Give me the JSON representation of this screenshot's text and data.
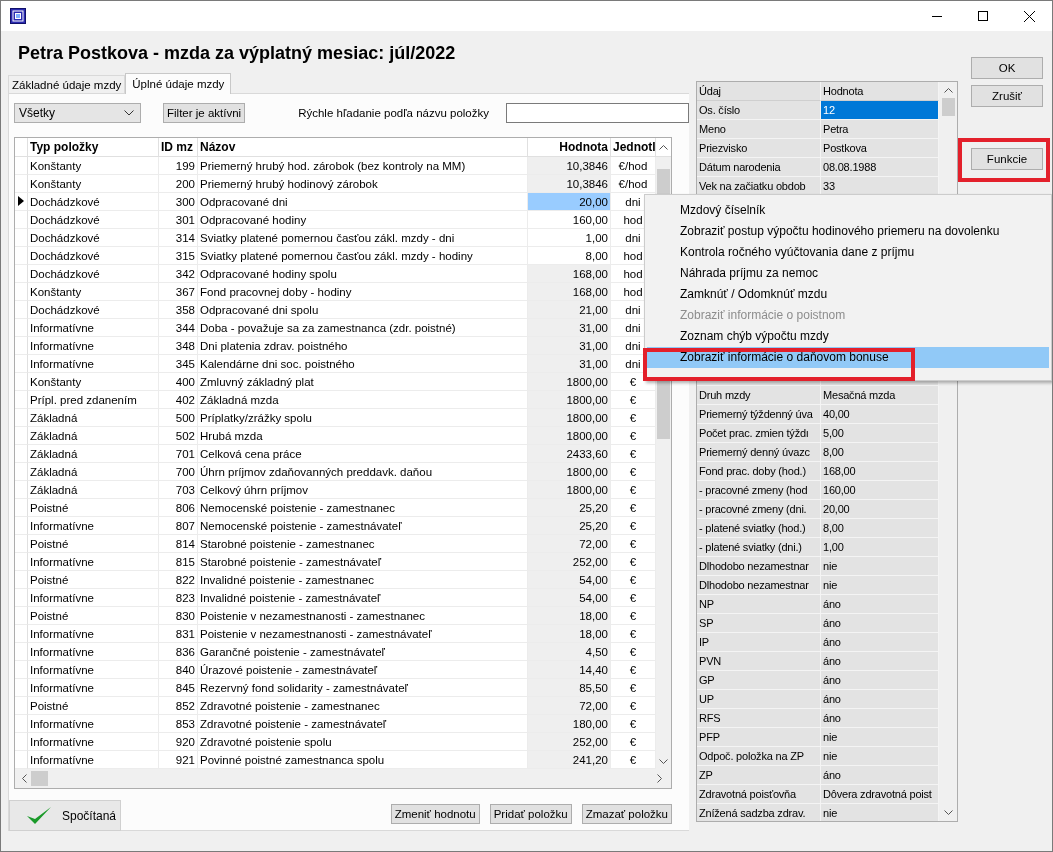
{
  "heading": "Petra Postkova - mzda za výplatný mesiac: júl/2022",
  "tabs": [
    {
      "label": "Základné údaje mzdy",
      "selected": false
    },
    {
      "label": "Úplné údaje mzdy",
      "selected": true
    }
  ],
  "filter": {
    "dropdown": "Všetky",
    "filter_button": "Filter je aktívni",
    "search_label": "Rýchle hľadanie podľa názvu položky"
  },
  "table": {
    "columns": [
      "Typ položky",
      "ID mz",
      "Názov",
      "Hodnota",
      "Jednotl"
    ],
    "rows": [
      {
        "type": "Konštanty",
        "id": "199",
        "name": "Priemerný hrubý hod. zárobok (bez kontroly na MM)",
        "value": "10,3846",
        "unit": "€/hod",
        "editable": false,
        "selected": false
      },
      {
        "type": "Konštanty",
        "id": "200",
        "name": "Priemerný hrubý hodinový zárobok",
        "value": "10,3846",
        "unit": "€/hod",
        "editable": false,
        "selected": false
      },
      {
        "type": "Dochádzkové",
        "id": "300",
        "name": "Odpracované dni",
        "value": "20,00",
        "unit": "dni",
        "editable": true,
        "selected": true
      },
      {
        "type": "Dochádzkové",
        "id": "301",
        "name": "Odpracované hodiny",
        "value": "160,00",
        "unit": "hod",
        "editable": true,
        "selected": false
      },
      {
        "type": "Dochádzkové",
        "id": "314",
        "name": "Sviatky platené pomernou časťou zákl. mzdy - dni",
        "value": "1,00",
        "unit": "dni",
        "editable": true,
        "selected": false
      },
      {
        "type": "Dochádzkové",
        "id": "315",
        "name": "Sviatky platené pomernou časťou zákl. mzdy - hodiny",
        "value": "8,00",
        "unit": "hod",
        "editable": true,
        "selected": false
      },
      {
        "type": "Dochádzkové",
        "id": "342",
        "name": "Odpracované hodiny spolu",
        "value": "168,00",
        "unit": "hod",
        "editable": false,
        "selected": false
      },
      {
        "type": "Konštanty",
        "id": "367",
        "name": "Fond pracovnej doby - hodiny",
        "value": "168,00",
        "unit": "hod",
        "editable": false,
        "selected": false
      },
      {
        "type": "Dochádzkové",
        "id": "358",
        "name": "Odpracované dni spolu",
        "value": "21,00",
        "unit": "dni",
        "editable": false,
        "selected": false
      },
      {
        "type": "Informatívne",
        "id": "344",
        "name": "Doba - považuje sa za zamestnanca (zdr. poistné)",
        "value": "31,00",
        "unit": "dni",
        "editable": false,
        "selected": false
      },
      {
        "type": "Informatívne",
        "id": "348",
        "name": "Dni platenia zdrav. poistného",
        "value": "31,00",
        "unit": "dni",
        "editable": false,
        "selected": false
      },
      {
        "type": "Informatívne",
        "id": "345",
        "name": "Kalendárne dni soc. poistného",
        "value": "31,00",
        "unit": "dni",
        "editable": false,
        "selected": false
      },
      {
        "type": "Konštanty",
        "id": "400",
        "name": "Zmluvný základný plat",
        "value": "1800,00",
        "unit": "€",
        "editable": false,
        "selected": false
      },
      {
        "type": "Prípl. pred zdanením",
        "id": "402",
        "name": "Základná mzda",
        "value": "1800,00",
        "unit": "€",
        "editable": false,
        "selected": false
      },
      {
        "type": "Základná",
        "id": "500",
        "name": "Príplatky/zrážky spolu",
        "value": "1800,00",
        "unit": "€",
        "editable": false,
        "selected": false
      },
      {
        "type": "Základná",
        "id": "502",
        "name": "Hrubá mzda",
        "value": "1800,00",
        "unit": "€",
        "editable": false,
        "selected": false
      },
      {
        "type": "Základná",
        "id": "701",
        "name": "Celková cena práce",
        "value": "2433,60",
        "unit": "€",
        "editable": false,
        "selected": false
      },
      {
        "type": "Základná",
        "id": "700",
        "name": "Úhrn príjmov zdaňovanných preddavk. daňou",
        "value": "1800,00",
        "unit": "€",
        "editable": false,
        "selected": false
      },
      {
        "type": "Základná",
        "id": "703",
        "name": "Celkový úhrn príjmov",
        "value": "1800,00",
        "unit": "€",
        "editable": false,
        "selected": false
      },
      {
        "type": "Poistné",
        "id": "806",
        "name": "Nemocenské poistenie - zamestnanec",
        "value": "25,20",
        "unit": "€",
        "editable": false,
        "selected": false
      },
      {
        "type": "Informatívne",
        "id": "807",
        "name": "Nemocenské poistenie - zamestnávateľ",
        "value": "25,20",
        "unit": "€",
        "editable": false,
        "selected": false
      },
      {
        "type": "Poistné",
        "id": "814",
        "name": "Starobné poistenie - zamestnanec",
        "value": "72,00",
        "unit": "€",
        "editable": false,
        "selected": false
      },
      {
        "type": "Informatívne",
        "id": "815",
        "name": "Starobné poistenie - zamestnávateľ",
        "value": "252,00",
        "unit": "€",
        "editable": false,
        "selected": false
      },
      {
        "type": "Poistné",
        "id": "822",
        "name": "Invalidné poistenie - zamestnanec",
        "value": "54,00",
        "unit": "€",
        "editable": false,
        "selected": false
      },
      {
        "type": "Informatívne",
        "id": "823",
        "name": "Invalidné poistenie - zamestnávateľ",
        "value": "54,00",
        "unit": "€",
        "editable": false,
        "selected": false
      },
      {
        "type": "Poistné",
        "id": "830",
        "name": "Poistenie v nezamestnanosti - zamestnanec",
        "value": "18,00",
        "unit": "€",
        "editable": false,
        "selected": false
      },
      {
        "type": "Informatívne",
        "id": "831",
        "name": "Poistenie v nezamestnanosti - zamestnávateľ",
        "value": "18,00",
        "unit": "€",
        "editable": false,
        "selected": false
      },
      {
        "type": "Informatívne",
        "id": "836",
        "name": "Garančné poistenie - zamestnávateľ",
        "value": "4,50",
        "unit": "€",
        "editable": false,
        "selected": false
      },
      {
        "type": "Informatívne",
        "id": "840",
        "name": "Úrazové poistenie - zamestnávateľ",
        "value": "14,40",
        "unit": "€",
        "editable": false,
        "selected": false
      },
      {
        "type": "Informatívne",
        "id": "845",
        "name": "Rezervný fond solidarity - zamestnávateľ",
        "value": "85,50",
        "unit": "€",
        "editable": false,
        "selected": false
      },
      {
        "type": "Poistné",
        "id": "852",
        "name": "Zdravotné poistenie - zamestnanec",
        "value": "72,00",
        "unit": "€",
        "editable": false,
        "selected": false
      },
      {
        "type": "Informatívne",
        "id": "853",
        "name": "Zdravotné poistenie - zamestnávateľ",
        "value": "180,00",
        "unit": "€",
        "editable": false,
        "selected": false
      },
      {
        "type": "Informatívne",
        "id": "920",
        "name": "Zdravotné poistenie spolu",
        "value": "252,00",
        "unit": "€",
        "editable": false,
        "selected": false
      },
      {
        "type": "Informatívne",
        "id": "921",
        "name": "Povinné poistné zamestnanca spolu",
        "value": "241,20",
        "unit": "€",
        "editable": false,
        "selected": false
      }
    ]
  },
  "status": "Spočítaná",
  "table_buttons": [
    "Zmeniť hodnotu",
    "Pridať položku",
    "Zmazať položku"
  ],
  "property_grid": {
    "columns": [
      "Údaj",
      "Hodnota"
    ],
    "upper_rows": [
      {
        "label": "Os. číslo",
        "value": "12",
        "selected": true
      },
      {
        "label": "Meno",
        "value": "Petra",
        "selected": false
      },
      {
        "label": "Priezvisko",
        "value": "Postkova",
        "selected": false
      },
      {
        "label": "Dátum narodenia",
        "value": "08.08.1988",
        "selected": false
      },
      {
        "label": "Vek na začiatku obdob",
        "value": "33",
        "selected": false
      }
    ],
    "lower_rows": [
      {
        "label": "Druh mzdy",
        "value": "Mesačná mzda",
        "selected": false
      },
      {
        "label": "Priemerný týždenný úva",
        "value": "40,00",
        "selected": false
      },
      {
        "label": "Počet prac. zmien týždı",
        "value": "5,00",
        "selected": false
      },
      {
        "label": "Priemerný denný úvazc",
        "value": "8,00",
        "selected": false
      },
      {
        "label": "Fond prac. doby (hod.)",
        "value": "168,00",
        "selected": false
      },
      {
        "label": "- pracovné zmeny (hod",
        "value": "160,00",
        "selected": false
      },
      {
        "label": "- pracovné zmeny (dni.",
        "value": "20,00",
        "selected": false
      },
      {
        "label": "- platené sviatky (hod.)",
        "value": "8,00",
        "selected": false
      },
      {
        "label": "- platené sviatky (dni.)",
        "value": "1,00",
        "selected": false
      },
      {
        "label": "Dlhodobo nezamestnar",
        "value": "nie",
        "selected": false
      },
      {
        "label": "Dlhodobo nezamestnar",
        "value": "nie",
        "selected": false
      },
      {
        "label": "NP",
        "value": "áno",
        "selected": false
      },
      {
        "label": "SP",
        "value": "áno",
        "selected": false
      },
      {
        "label": "IP",
        "value": "áno",
        "selected": false
      },
      {
        "label": "PVN",
        "value": "áno",
        "selected": false
      },
      {
        "label": "GP",
        "value": "áno",
        "selected": false
      },
      {
        "label": "UP",
        "value": "áno",
        "selected": false
      },
      {
        "label": "RFS",
        "value": "áno",
        "selected": false
      },
      {
        "label": "PFP",
        "value": "nie",
        "selected": false
      },
      {
        "label": "Odpoč. položka na ZP",
        "value": "nie",
        "selected": false
      },
      {
        "label": "ZP",
        "value": "áno",
        "selected": false
      },
      {
        "label": "Zdravotná poisťovňa",
        "value": "Dôvera zdravotná poist",
        "selected": false
      },
      {
        "label": "Znížená sadzba zdrav.",
        "value": "nie",
        "selected": false
      }
    ]
  },
  "dialog_buttons": [
    "OK",
    "Zrušiť"
  ],
  "functions_button": "Funkcie",
  "context_menu": [
    {
      "label": "Mzdový číselník",
      "disabled": false,
      "selected": false
    },
    {
      "label": "Zobraziť postup výpočtu hodinového priemeru na dovolenku",
      "disabled": false,
      "selected": false
    },
    {
      "label": "Kontrola ročného vyúčtovania dane z príjmu",
      "disabled": false,
      "selected": false
    },
    {
      "label": "Náhrada príjmu za nemoc",
      "disabled": false,
      "selected": false
    },
    {
      "label": "Zamknúť / Odomknúť mzdu",
      "disabled": false,
      "selected": false
    },
    {
      "label": "Zobraziť informácie o poistnom",
      "disabled": true,
      "selected": false
    },
    {
      "label": "Zoznam chýb výpočtu mzdy",
      "disabled": false,
      "selected": false
    },
    {
      "label": "Zobraziť informácie o daňovom bonuse",
      "disabled": false,
      "selected": true
    }
  ]
}
